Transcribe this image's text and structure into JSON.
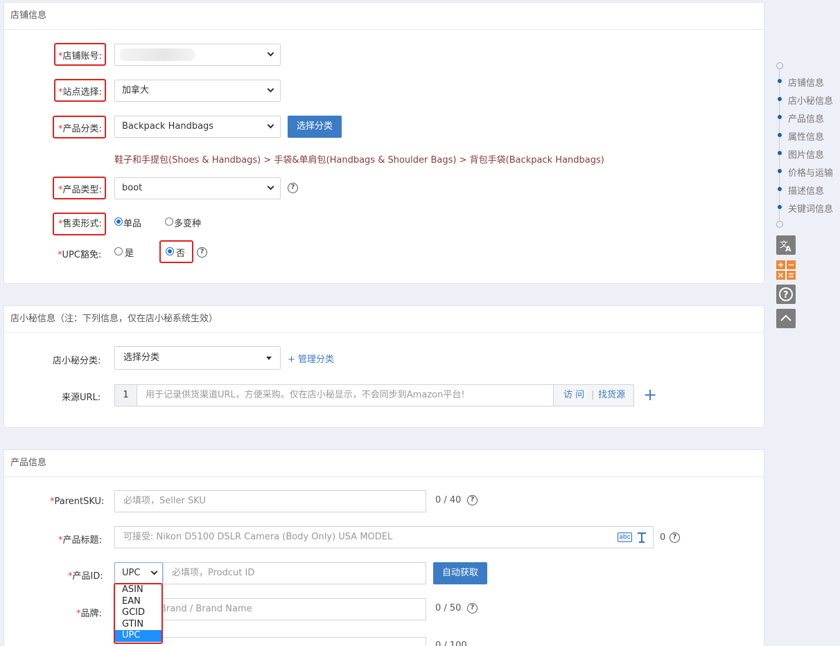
{
  "store_section": {
    "title": "店铺信息",
    "store_account_label": "店铺账号:",
    "site_label": "站点选择:",
    "site_value": "加拿大",
    "category_label": "产品分类:",
    "category_value": "Backpack Handbags",
    "choose_category_button": "选择分类",
    "category_path": "鞋子和手提包(Shoes & Handbags) > 手袋&单肩包(Handbags & Shoulder Bags) > 背包手袋(Backpack Handbags)",
    "product_type_label": "产品类型:",
    "product_type_value": "boot",
    "sale_form_label": "售卖形式:",
    "sale_form_options": [
      "单品",
      "多变种"
    ],
    "sale_form_selected": "单品",
    "upc_exempt_label": "UPC豁免:",
    "upc_exempt_options": [
      "是",
      "否"
    ],
    "upc_exempt_selected": "否",
    "required_mark": "*"
  },
  "dxm_section": {
    "title": "店小秘信息（注：下列信息，仅在店小秘系统生效）",
    "category_label": "店小秘分类:",
    "category_placeholder": "选择分类",
    "manage_category_link": "+ 管理分类",
    "source_url_label": "来源URL:",
    "source_url_index": "1",
    "source_url_placeholder": "用于记录供货渠道URL，方便采购。仅在店小秘显示，不会同步到Amazon平台!",
    "visit_link": "访 问",
    "divider": "|",
    "find_source_link": "找货源",
    "add_icon": "+"
  },
  "product_section": {
    "title": "产品信息",
    "parent_sku_label": "ParentSKU:",
    "parent_sku_placeholder": "必填项，Seller SKU",
    "parent_sku_counter": "0 / 40",
    "product_title_label": "产品标题:",
    "product_title_placeholder": "可接受: Nikon D5100 DSLR Camera (Body Only) USA MODEL",
    "product_title_counter": "0",
    "spellcheck_icon_text": "abc",
    "product_id_label": "产品ID:",
    "product_id_type": "UPC",
    "product_id_placeholder": "必填项，Prodcut ID",
    "auto_fetch_button": "自动获取",
    "brand_label": "品牌:",
    "brand_placeholder": "Brand / Brand Name",
    "brand_counter": "0 / 50",
    "next_counter": "0 / 100",
    "id_type_options": [
      "ASIN",
      "EAN",
      "GCID",
      "GTIN",
      "UPC"
    ],
    "id_type_active": "UPC"
  },
  "side_nav": {
    "items": [
      "店铺信息",
      "店小秘信息",
      "产品信息",
      "属性信息",
      "图片信息",
      "价格与运输",
      "描述信息",
      "关键词信息"
    ]
  },
  "colors": {
    "primary": "#3b7cc5",
    "required": "#e53935",
    "highlight_border": "#e02020",
    "breadcrumb": "#8b3a3a",
    "dropdown_active": "#1e90ff",
    "calc_orange": "#f0883a"
  }
}
